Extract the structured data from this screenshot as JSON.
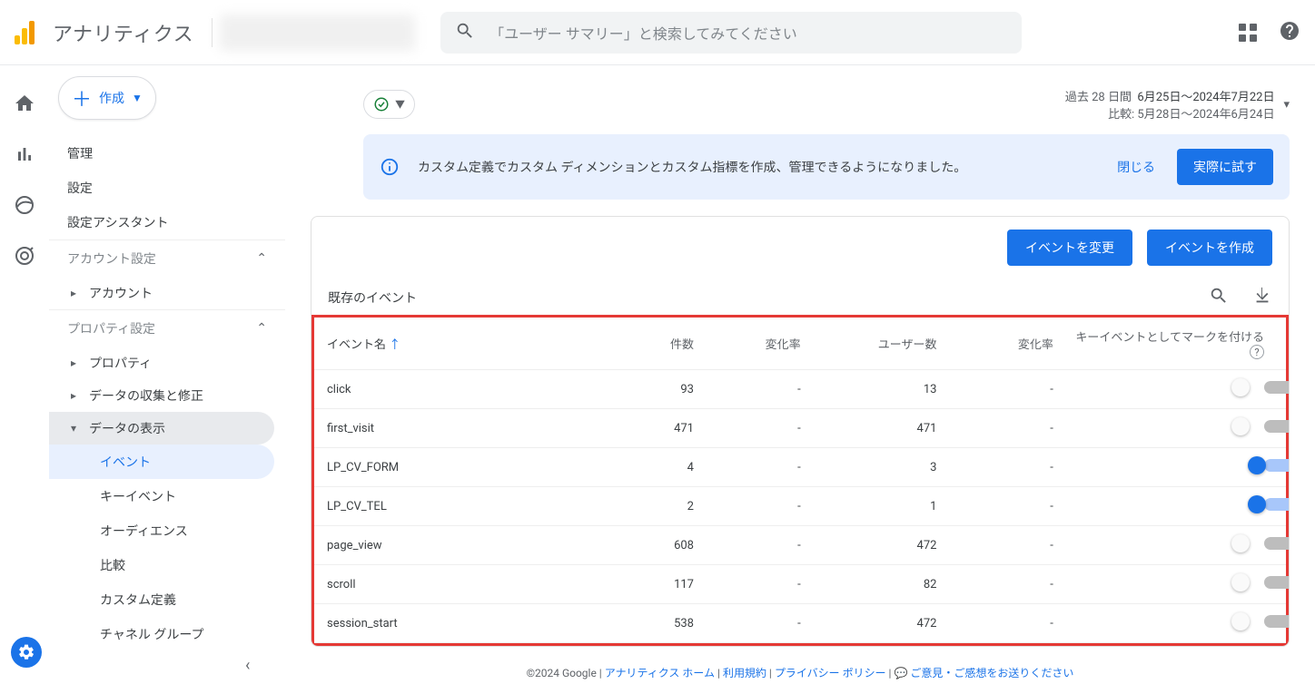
{
  "header": {
    "app_title": "アナリティクス",
    "search_placeholder": "「ユーザー サマリー」と検索してみてください"
  },
  "create_button": {
    "label": "作成"
  },
  "sidebar": {
    "links": [
      "管理",
      "設定",
      "設定アシスタント"
    ],
    "section_account": "アカウント設定",
    "account_item": "アカウント",
    "section_property": "プロパティ設定",
    "property_items": [
      "プロパティ",
      "データの収集と修正",
      "データの表示"
    ],
    "sub_items": [
      "イベント",
      "キーイベント",
      "オーディエンス",
      "比較",
      "カスタム定義",
      "チャネル グループ"
    ]
  },
  "date": {
    "prefix": "過去 28 日間",
    "range": "6月25日～2024年7月22日",
    "compare": "比較: 5月28日～2024年6月24日"
  },
  "banner": {
    "message": "カスタム定義でカスタム ディメンションとカスタム指標を作成、管理できるようになりました。",
    "close": "閉じる",
    "try": "実際に試す"
  },
  "card": {
    "edit_btn": "イベントを変更",
    "create_btn": "イベントを作成",
    "title": "既存のイベント",
    "columns": {
      "name": "イベント名",
      "count": "件数",
      "change": "変化率",
      "users": "ユーザー数",
      "change2": "変化率",
      "mark": "キーイベントとしてマークを付ける"
    },
    "rows": [
      {
        "name": "click",
        "count": "93",
        "change": "-",
        "users": "13",
        "change2": "-",
        "on": false
      },
      {
        "name": "first_visit",
        "count": "471",
        "change": "-",
        "users": "471",
        "change2": "-",
        "on": false
      },
      {
        "name": "LP_CV_FORM",
        "count": "4",
        "change": "-",
        "users": "3",
        "change2": "-",
        "on": true
      },
      {
        "name": "LP_CV_TEL",
        "count": "2",
        "change": "-",
        "users": "1",
        "change2": "-",
        "on": true
      },
      {
        "name": "page_view",
        "count": "608",
        "change": "-",
        "users": "472",
        "change2": "-",
        "on": false
      },
      {
        "name": "scroll",
        "count": "117",
        "change": "-",
        "users": "82",
        "change2": "-",
        "on": false
      },
      {
        "name": "session_start",
        "count": "538",
        "change": "-",
        "users": "472",
        "change2": "-",
        "on": false
      }
    ]
  },
  "footer": {
    "copyright": "©2024 Google",
    "home": "アナリティクス ホーム",
    "terms": "利用規約",
    "privacy": "プライバシー ポリシー",
    "feedback": "ご意見・ご感想をお送りください"
  }
}
